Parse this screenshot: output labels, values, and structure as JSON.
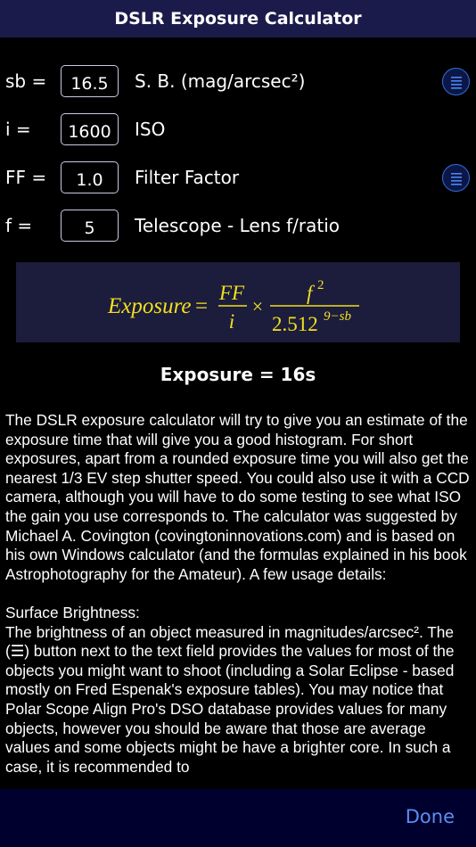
{
  "header": {
    "title": "DSLR Exposure Calculator"
  },
  "inputs": [
    {
      "var": "sb =",
      "value": "16.5",
      "desc": "S. B. (mag/arcsec²)",
      "has_list": true
    },
    {
      "var": "i =",
      "value": "1600",
      "desc": "ISO",
      "has_list": false
    },
    {
      "var": "FF =",
      "value": "1.0",
      "desc": "Filter Factor",
      "has_list": true
    },
    {
      "var": "f =",
      "value": "5",
      "desc": "Telescope - Lens f/ratio",
      "has_list": false
    }
  ],
  "formula": {
    "lhs": "Exposure",
    "eq": "=",
    "frac1_num": "FF",
    "frac1_den": "i",
    "times": "×",
    "frac2_num_base": "f",
    "frac2_num_exp": "2",
    "frac2_den_base": "2.512",
    "frac2_den_exp": "9−sb",
    "color": "#f0e020",
    "background": "#1c1c3c"
  },
  "result": "Exposure = 16s",
  "description": {
    "p1": "The DSLR exposure calculator will try to give you an estimate of the exposure time that will give you a good histogram. For short exposures, apart from a rounded exposure time you will also get the nearest 1/3 EV step shutter speed. You could also use it with a CCD camera, although you will have to do some testing to see what ISO the gain you use corresponds to. The calculator was suggested by Michael A. Covington (covingtoninnovations.com) and is based on his own Windows calculator (and the formulas explained in his book Astrophotography for the Amateur). A few usage details:",
    "h2": "Surface Brightness:",
    "p2": "The brightness of an object measured in magnitudes/arcsec². The (☰) button next to the text field provides the values for most of the objects you might want to shoot (including a Solar Eclipse - based mostly on Fred Espenak's exposure tables). You may notice that Polar Scope Align Pro's DSO database provides values for many objects, however you should be aware that those are average values and some objects might be have a brighter core. In such a case, it is recommended to"
  },
  "footer": {
    "done": "Done"
  },
  "colors": {
    "header_bg": "#1b1b4b",
    "accent": "#5e8df0",
    "bottom_bar": "#00002e"
  },
  "icons": {
    "list_button": "list-icon"
  }
}
